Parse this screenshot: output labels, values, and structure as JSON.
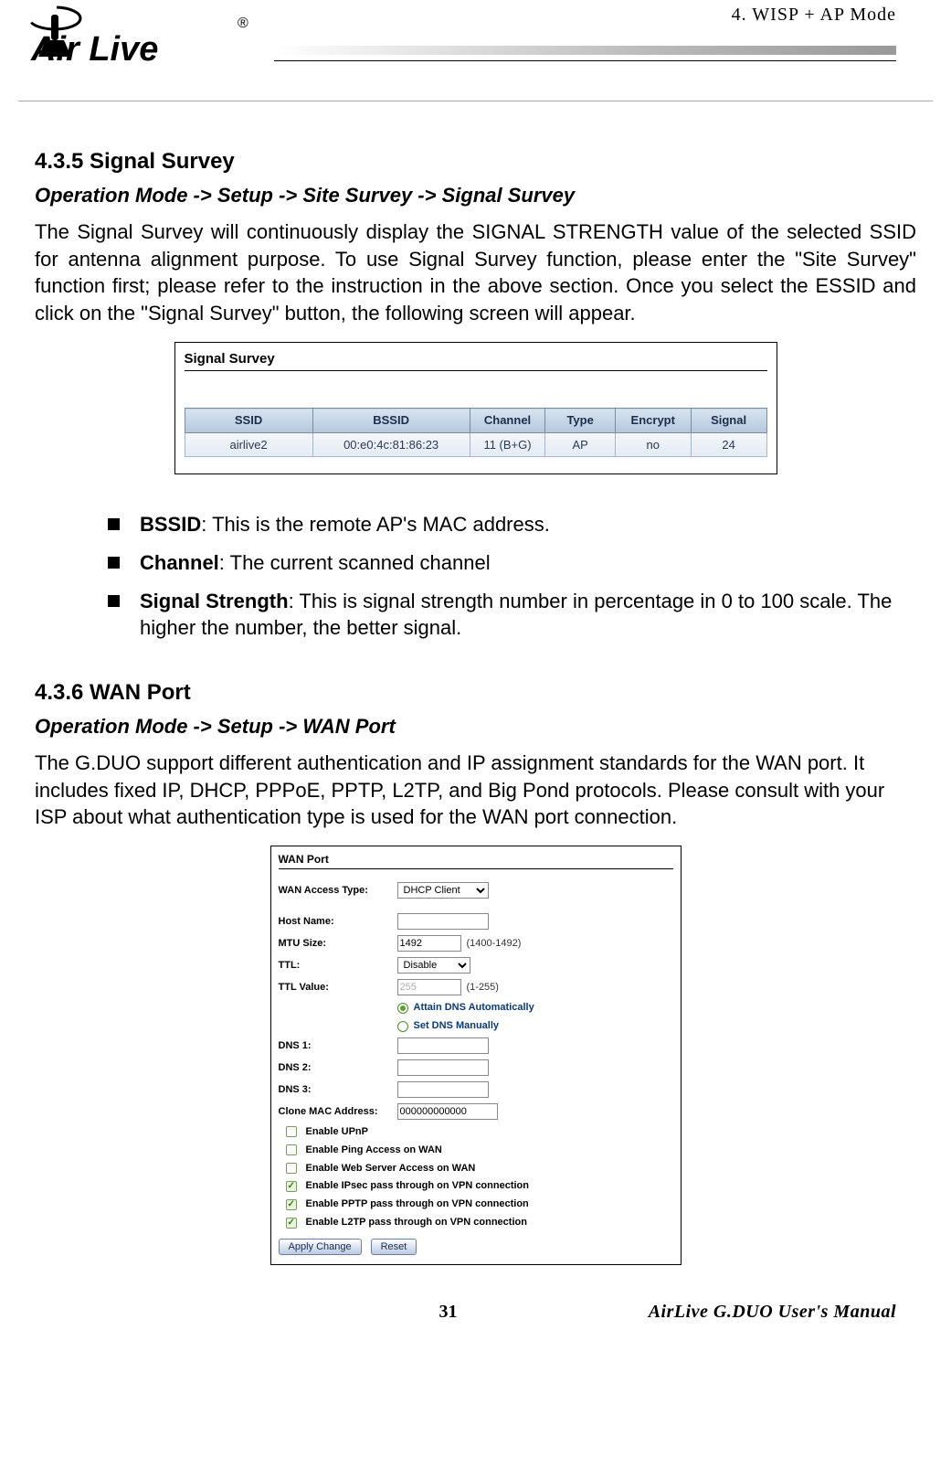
{
  "header": {
    "breadcrumb": "4.  WISP  +  AP  Mode",
    "logo_tm": "®",
    "logo_text_top": "Air Live"
  },
  "sec1": {
    "title": "4.3.5 Signal Survey",
    "breadcrumb": "Operation Mode -> Setup -> Site Survey -> Signal Survey",
    "paragraph": "The Signal Survey will continuously display the SIGNAL STRENGTH value of the selected SSID for antenna alignment purpose.  To use Signal Survey function, please enter the \"Site Survey\" function first; please refer to the instruction in the above section.   Once you select the ESSID and click on the \"Signal Survey\" button, the following screen will appear."
  },
  "survey": {
    "title": "Signal Survey",
    "headers": {
      "ssid": "SSID",
      "bssid": "BSSID",
      "channel": "Channel",
      "type": "Type",
      "encrypt": "Encrypt",
      "signal": "Signal"
    },
    "row": {
      "ssid": "airlive2",
      "bssid": "00:e0:4c:81:86:23",
      "channel": "11 (B+G)",
      "type": "AP",
      "encrypt": "no",
      "signal": "24"
    }
  },
  "bullets": {
    "b1_label": "BSSID",
    "b1_text": ": This is the remote AP's MAC address.",
    "b2_label": "Channel",
    "b2_text": ":   The current scanned channel",
    "b3_label": "Signal Strength",
    "b3_text": ": This is signal strength number in percentage in 0 to 100 scale. The higher the number, the better signal."
  },
  "sec2": {
    "title": "4.3.6 WAN Port",
    "breadcrumb": "Operation Mode -> Setup -> WAN Port",
    "paragraph": "The G.DUO support different authentication and IP assignment standards for the WAN port. It includes fixed IP, DHCP, PPPoE, PPTP, L2TP, and Big Pond protocols.   Please consult with your ISP about what authentication type is used for the WAN port connection."
  },
  "wan": {
    "title": "WAN Port",
    "access_type_label": "WAN Access Type:",
    "access_type_value": "DHCP Client",
    "hostname_label": "Host Name:",
    "hostname_value": "",
    "mtu_label": "MTU Size:",
    "mtu_value": "1492",
    "mtu_hint": "(1400-1492)",
    "ttl_label": "TTL:",
    "ttl_value": "Disable",
    "ttlval_label": "TTL Value:",
    "ttlval_value": "255",
    "ttlval_hint": "(1-255)",
    "radio_auto": "Attain DNS Automatically",
    "radio_manual": "Set DNS Manually",
    "dns1_label": "DNS 1:",
    "dns2_label": "DNS 2:",
    "dns3_label": "DNS 3:",
    "dns_value": "",
    "clone_label": "Clone MAC Address:",
    "clone_value": "000000000000",
    "chk_upnp": "Enable UPnP",
    "chk_ping": "Enable Ping Access on WAN",
    "chk_web": "Enable Web Server Access on WAN",
    "chk_ipsec": "Enable IPsec pass through on VPN connection",
    "chk_pptp": "Enable PPTP pass through on VPN connection",
    "chk_l2tp": "Enable L2TP pass through on VPN connection",
    "btn_apply": "Apply Change",
    "btn_reset": "Reset"
  },
  "footer": {
    "page": "31",
    "manual": "AirLive  G.DUO  User's  Manual"
  }
}
